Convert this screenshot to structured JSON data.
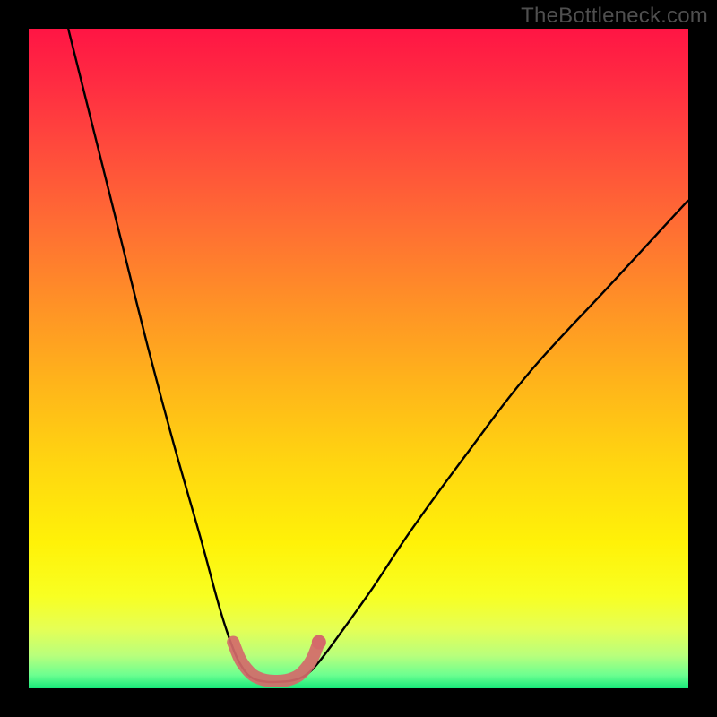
{
  "watermark": "TheBottleneck.com",
  "chart_data": {
    "type": "line",
    "title": "",
    "xlabel": "",
    "ylabel": "",
    "xlim": [
      0,
      100
    ],
    "ylim": [
      0,
      100
    ],
    "grid": false,
    "legend": false,
    "note": "Axes are unlabeled; values are estimated from pixel positions on a 0-100 normalized scale. The figure shows a V-shaped bottleneck curve on a vertical heat gradient (red=high, green=low). A short pink marker segment highlights the trough region.",
    "gradient_stops": [
      {
        "pos": 0.0,
        "color": "#ff1544"
      },
      {
        "pos": 0.08,
        "color": "#ff2b42"
      },
      {
        "pos": 0.18,
        "color": "#ff4a3c"
      },
      {
        "pos": 0.3,
        "color": "#ff6e33"
      },
      {
        "pos": 0.42,
        "color": "#ff9226"
      },
      {
        "pos": 0.54,
        "color": "#ffb51a"
      },
      {
        "pos": 0.66,
        "color": "#ffd610"
      },
      {
        "pos": 0.78,
        "color": "#fff208"
      },
      {
        "pos": 0.86,
        "color": "#f8ff22"
      },
      {
        "pos": 0.91,
        "color": "#e5ff55"
      },
      {
        "pos": 0.95,
        "color": "#b9ff7c"
      },
      {
        "pos": 0.98,
        "color": "#6cff90"
      },
      {
        "pos": 1.0,
        "color": "#17e87a"
      }
    ],
    "series": [
      {
        "name": "bottleneck-curve",
        "color": "#000000",
        "x": [
          6,
          10,
          14,
          18,
          22,
          26,
          29,
          31,
          32.5,
          34,
          36,
          38,
          40,
          42,
          44,
          47,
          52,
          58,
          66,
          76,
          88,
          100
        ],
        "y": [
          100,
          84,
          68,
          52,
          37,
          23,
          12,
          6,
          3,
          1.5,
          1,
          1,
          1.2,
          2,
          4,
          8,
          15,
          24,
          35,
          48,
          61,
          74
        ]
      },
      {
        "name": "trough-highlight",
        "color": "#d46a6a",
        "x": [
          31,
          32,
          33,
          34,
          35,
          36,
          37,
          38,
          39,
          40,
          41,
          42,
          43,
          44
        ],
        "y": [
          7,
          4.5,
          3,
          2,
          1.5,
          1.2,
          1.1,
          1.1,
          1.2,
          1.5,
          2,
          3,
          4.5,
          7
        ]
      }
    ]
  }
}
